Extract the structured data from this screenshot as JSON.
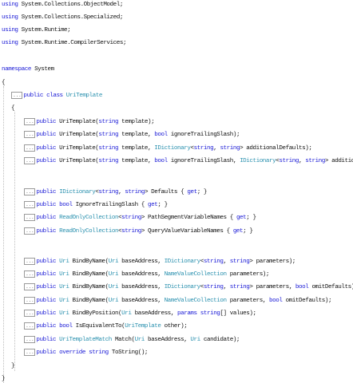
{
  "colors": {
    "keyword": "#1a1ad6",
    "type": "#2b91af",
    "text": "#111111",
    "collapse_marker": "#808080"
  },
  "collapsed_marker_text": "...",
  "lines": [
    [
      [
        "kw",
        "using"
      ],
      [
        "t",
        " System.Collections.ObjectModel;"
      ]
    ],
    [
      [
        "kw",
        "using"
      ],
      [
        "t",
        " System.Collections.Specialized;"
      ]
    ],
    [
      [
        "kw",
        "using"
      ],
      [
        "t",
        " System.Runtime;"
      ]
    ],
    [
      [
        "kw",
        "using"
      ],
      [
        "t",
        " System.Runtime.CompilerServices;"
      ]
    ],
    [],
    [
      [
        "kw",
        "namespace"
      ],
      [
        "t",
        " System"
      ]
    ],
    [
      [
        "t",
        "{"
      ]
    ],
    [
      [
        "m",
        ""
      ],
      [
        "kw",
        "public"
      ],
      [
        "t",
        " "
      ],
      [
        "kw",
        "class"
      ],
      [
        "t",
        " "
      ],
      [
        "ty",
        "UriTemplate"
      ]
    ],
    [
      [
        "t",
        "{"
      ]
    ],
    [
      [
        "m",
        ""
      ],
      [
        "kw",
        "public"
      ],
      [
        "t",
        " UriTemplate("
      ],
      [
        "kw",
        "string"
      ],
      [
        "t",
        " template);"
      ]
    ],
    [
      [
        "m",
        ""
      ],
      [
        "kw",
        "public"
      ],
      [
        "t",
        " UriTemplate("
      ],
      [
        "kw",
        "string"
      ],
      [
        "t",
        " template, "
      ],
      [
        "kw",
        "bool"
      ],
      [
        "t",
        " ignoreTrailingSlash);"
      ]
    ],
    [
      [
        "m",
        ""
      ],
      [
        "kw",
        "public"
      ],
      [
        "t",
        " UriTemplate("
      ],
      [
        "kw",
        "string"
      ],
      [
        "t",
        " template, "
      ],
      [
        "ty",
        "IDictionary"
      ],
      [
        "t",
        "<"
      ],
      [
        "kw",
        "string"
      ],
      [
        "t",
        ", "
      ],
      [
        "kw",
        "string"
      ],
      [
        "t",
        "> additionalDefaults);"
      ]
    ],
    [
      [
        "m",
        ""
      ],
      [
        "kw",
        "public"
      ],
      [
        "t",
        " UriTemplate("
      ],
      [
        "kw",
        "string"
      ],
      [
        "t",
        " template, "
      ],
      [
        "kw",
        "bool"
      ],
      [
        "t",
        " ignoreTrailingSlash, "
      ],
      [
        "ty",
        "IDictionary"
      ],
      [
        "t",
        "<"
      ],
      [
        "kw",
        "string"
      ],
      [
        "t",
        ", "
      ],
      [
        "kw",
        "string"
      ],
      [
        "t",
        "> additionalDefaults);"
      ]
    ],
    [],
    [
      [
        "m",
        ""
      ],
      [
        "kw",
        "public"
      ],
      [
        "t",
        " "
      ],
      [
        "ty",
        "IDictionary"
      ],
      [
        "t",
        "<"
      ],
      [
        "kw",
        "string"
      ],
      [
        "t",
        ", "
      ],
      [
        "kw",
        "string"
      ],
      [
        "t",
        "> Defaults { "
      ],
      [
        "kw",
        "get"
      ],
      [
        "t",
        "; }"
      ]
    ],
    [
      [
        "m",
        ""
      ],
      [
        "kw",
        "public"
      ],
      [
        "t",
        " "
      ],
      [
        "kw",
        "bool"
      ],
      [
        "t",
        " IgnoreTrailingSlash { "
      ],
      [
        "kw",
        "get"
      ],
      [
        "t",
        "; }"
      ]
    ],
    [
      [
        "m",
        ""
      ],
      [
        "kw",
        "public"
      ],
      [
        "t",
        " "
      ],
      [
        "ty",
        "ReadOnlyCollection"
      ],
      [
        "t",
        "<"
      ],
      [
        "kw",
        "string"
      ],
      [
        "t",
        "> PathSegmentVariableNames { "
      ],
      [
        "kw",
        "get"
      ],
      [
        "t",
        "; }"
      ]
    ],
    [
      [
        "m",
        ""
      ],
      [
        "kw",
        "public"
      ],
      [
        "t",
        " "
      ],
      [
        "ty",
        "ReadOnlyCollection"
      ],
      [
        "t",
        "<"
      ],
      [
        "kw",
        "string"
      ],
      [
        "t",
        "> QueryValueVariableNames { "
      ],
      [
        "kw",
        "get"
      ],
      [
        "t",
        "; }"
      ]
    ],
    [],
    [
      [
        "m",
        ""
      ],
      [
        "kw",
        "public"
      ],
      [
        "t",
        " "
      ],
      [
        "ty",
        "Uri"
      ],
      [
        "t",
        " BindByName("
      ],
      [
        "ty",
        "Uri"
      ],
      [
        "t",
        " baseAddress, "
      ],
      [
        "ty",
        "IDictionary"
      ],
      [
        "t",
        "<"
      ],
      [
        "kw",
        "string"
      ],
      [
        "t",
        ", "
      ],
      [
        "kw",
        "string"
      ],
      [
        "t",
        "> parameters);"
      ]
    ],
    [
      [
        "m",
        ""
      ],
      [
        "kw",
        "public"
      ],
      [
        "t",
        " "
      ],
      [
        "ty",
        "Uri"
      ],
      [
        "t",
        " BindByName("
      ],
      [
        "ty",
        "Uri"
      ],
      [
        "t",
        " baseAddress, "
      ],
      [
        "ty",
        "NameValueCollection"
      ],
      [
        "t",
        " parameters);"
      ]
    ],
    [
      [
        "m",
        ""
      ],
      [
        "kw",
        "public"
      ],
      [
        "t",
        " "
      ],
      [
        "ty",
        "Uri"
      ],
      [
        "t",
        " BindByName("
      ],
      [
        "ty",
        "Uri"
      ],
      [
        "t",
        " baseAddress, "
      ],
      [
        "ty",
        "IDictionary"
      ],
      [
        "t",
        "<"
      ],
      [
        "kw",
        "string"
      ],
      [
        "t",
        ", "
      ],
      [
        "kw",
        "string"
      ],
      [
        "t",
        "> parameters, "
      ],
      [
        "kw",
        "bool"
      ],
      [
        "t",
        " omitDefaults);"
      ]
    ],
    [
      [
        "m",
        ""
      ],
      [
        "kw",
        "public"
      ],
      [
        "t",
        " "
      ],
      [
        "ty",
        "Uri"
      ],
      [
        "t",
        " BindByName("
      ],
      [
        "ty",
        "Uri"
      ],
      [
        "t",
        " baseAddress, "
      ],
      [
        "ty",
        "NameValueCollection"
      ],
      [
        "t",
        " parameters, "
      ],
      [
        "kw",
        "bool"
      ],
      [
        "t",
        " omitDefaults);"
      ]
    ],
    [
      [
        "m",
        ""
      ],
      [
        "kw",
        "public"
      ],
      [
        "t",
        " "
      ],
      [
        "ty",
        "Uri"
      ],
      [
        "t",
        " BindByPosition("
      ],
      [
        "ty",
        "Uri"
      ],
      [
        "t",
        " baseAddress, "
      ],
      [
        "kw",
        "params"
      ],
      [
        "t",
        " "
      ],
      [
        "kw",
        "string"
      ],
      [
        "t",
        "[] values);"
      ]
    ],
    [
      [
        "m",
        ""
      ],
      [
        "kw",
        "public"
      ],
      [
        "t",
        " "
      ],
      [
        "kw",
        "bool"
      ],
      [
        "t",
        " IsEquivalentTo("
      ],
      [
        "ty",
        "UriTemplate"
      ],
      [
        "t",
        " other);"
      ]
    ],
    [
      [
        "m",
        ""
      ],
      [
        "kw",
        "public"
      ],
      [
        "t",
        " "
      ],
      [
        "ty",
        "UriTemplateMatch"
      ],
      [
        "t",
        " Match("
      ],
      [
        "ty",
        "Uri"
      ],
      [
        "t",
        " baseAddress, "
      ],
      [
        "ty",
        "Uri"
      ],
      [
        "t",
        " candidate);"
      ]
    ],
    [
      [
        "m",
        ""
      ],
      [
        "kw",
        "public"
      ],
      [
        "t",
        " "
      ],
      [
        "kw",
        "override"
      ],
      [
        "t",
        " "
      ],
      [
        "kw",
        "string"
      ],
      [
        "t",
        " ToString();"
      ]
    ],
    [
      [
        "t",
        "}"
      ]
    ],
    [
      [
        "t",
        "}"
      ]
    ]
  ]
}
